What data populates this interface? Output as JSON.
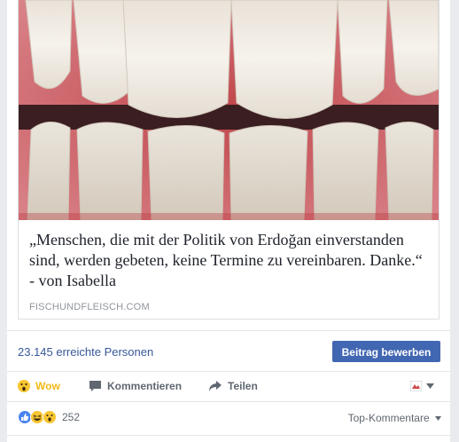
{
  "link_preview": {
    "headline": "„Menschen, die mit der Politik von Erdoğan einverstanden sind, werden gebeten, keine Termine zu vereinbaren. Danke.“ - von Isabella",
    "domain": "FISCHUNDFLEISCH.COM"
  },
  "insights": {
    "reach": "23.145 erreichte Personen",
    "boost_label": "Beitrag bewerben"
  },
  "actions": {
    "reaction_label": "Wow",
    "comment_label": "Kommentieren",
    "share_label": "Teilen"
  },
  "reactions_summary": {
    "count": "252",
    "sort_label": "Top-Kommentare"
  },
  "colors": {
    "link": "#365899",
    "button": "#4267b2",
    "wow": "#f0ba15"
  }
}
